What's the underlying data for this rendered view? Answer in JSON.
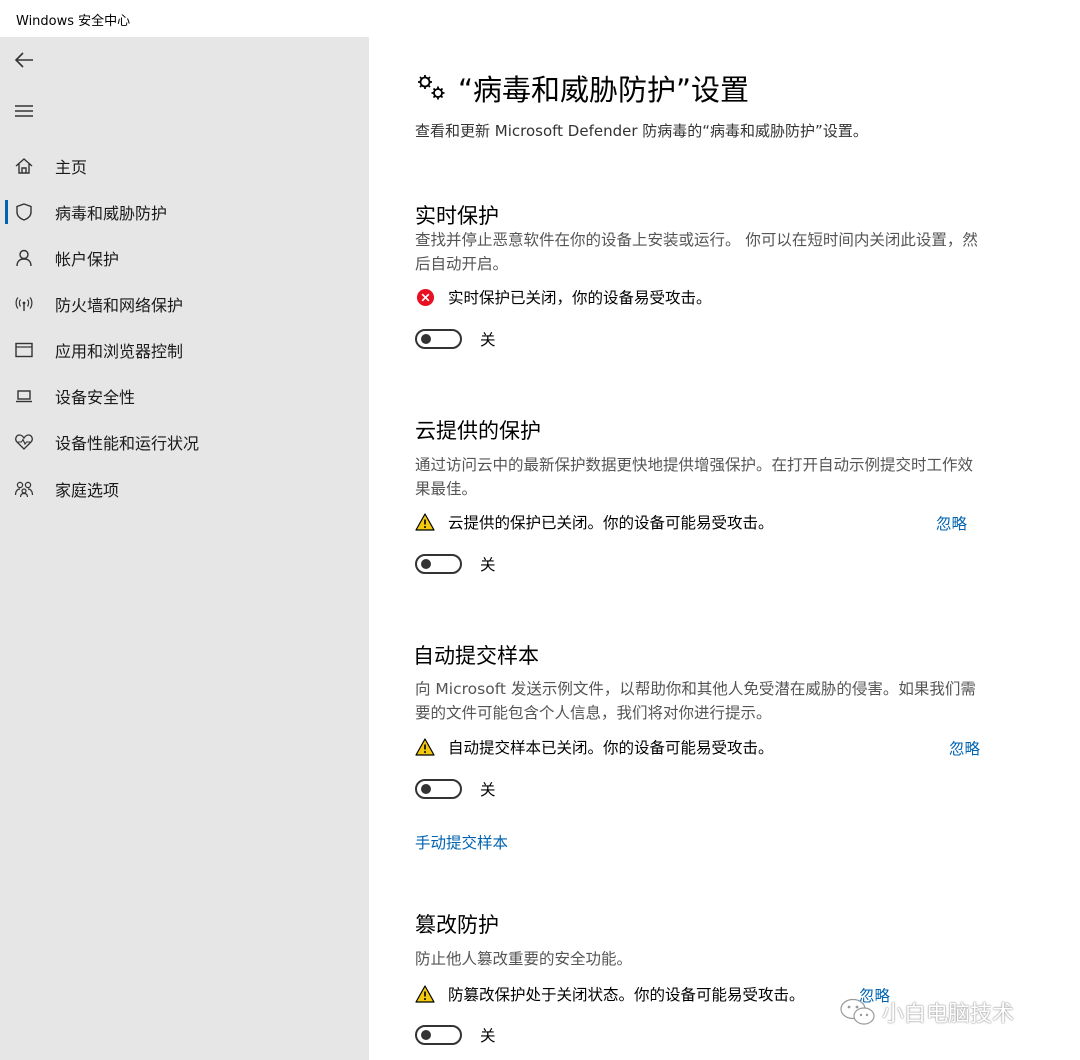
{
  "window": {
    "title": "Windows 安全中心"
  },
  "sidebar": {
    "items": [
      {
        "label": "主页",
        "icon": "home-icon",
        "selected": false
      },
      {
        "label": "病毒和威胁防护",
        "icon": "shield-icon",
        "selected": true
      },
      {
        "label": "帐户保护",
        "icon": "person-icon",
        "selected": false
      },
      {
        "label": "防火墙和网络保护",
        "icon": "wifi-antenna-icon",
        "selected": false
      },
      {
        "label": "应用和浏览器控制",
        "icon": "app-window-icon",
        "selected": false
      },
      {
        "label": "设备安全性",
        "icon": "laptop-icon",
        "selected": false
      },
      {
        "label": "设备性能和运行状况",
        "icon": "heart-pulse-icon",
        "selected": false
      },
      {
        "label": "家庭选项",
        "icon": "family-icon",
        "selected": false
      }
    ]
  },
  "page": {
    "title": "“病毒和威胁防护”设置",
    "description": "查看和更新 Microsoft Defender 防病毒的“病毒和威胁防护”设置。"
  },
  "sections": [
    {
      "title": "实时保护",
      "description": "查找并停止恶意软件在你的设备上安装或运行。 你可以在短时间内关闭此设置，然后自动开启。",
      "status_icon": "error-icon",
      "status": "实时保护已关闭，你的设备易受攻击。",
      "toggle_label": "关"
    },
    {
      "title": "云提供的保护",
      "description": "通过访问云中的最新保护数据更快地提供增强保护。在打开自动示例提交时工作效果最佳。",
      "status_icon": "warning-icon",
      "status": "云提供的保护已关闭。你的设备可能易受攻击。",
      "dismiss": "忽略",
      "toggle_label": "关"
    },
    {
      "title": "自动提交样本",
      "description": "向 Microsoft 发送示例文件，以帮助你和其他人免受潜在威胁的侵害。如果我们需要的文件可能包含个人信息，我们将对你进行提示。",
      "status_icon": "warning-icon",
      "status": "自动提交样本已关闭。你的设备可能易受攻击。",
      "dismiss": "忽略",
      "toggle_label": "关",
      "link": "手动提交样本"
    },
    {
      "title": "篡改防护",
      "description": "防止他人篡改重要的安全功能。",
      "status_icon": "warning-icon",
      "status": "防篡改保护处于关闭状态。你的设备可能易受攻击。",
      "dismiss": "忽略",
      "toggle_label": "关"
    }
  ],
  "watermark": {
    "text": "小白电脑技术",
    "icon": "wechat-icon"
  },
  "colors": {
    "sidebar_bg": "#e6e6e6",
    "accent": "#0063b1",
    "error": "#e81123",
    "warning": "#f2c811"
  }
}
